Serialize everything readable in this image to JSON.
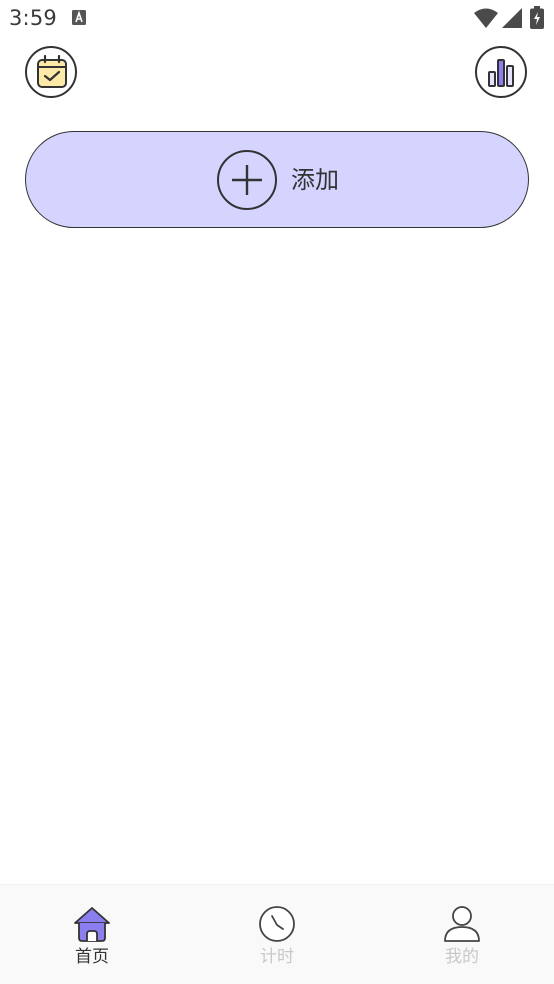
{
  "status_bar": {
    "time": "3:59",
    "icons": [
      "notification-a-icon",
      "wifi-icon",
      "signal-icon",
      "battery-charging-icon"
    ]
  },
  "header": {
    "left_icon": "calendar-check-icon",
    "right_icon": "bar-chart-icon"
  },
  "add_button": {
    "label": "添加",
    "icon": "plus-circle-icon",
    "color": "#d4d4ff"
  },
  "bottom_nav": {
    "items": [
      {
        "label": "首页",
        "icon": "home-icon",
        "active": true
      },
      {
        "label": "计时",
        "icon": "clock-icon",
        "active": false
      },
      {
        "label": "我的",
        "icon": "person-icon",
        "active": false
      }
    ],
    "accent_color": "#8b7ff0"
  }
}
